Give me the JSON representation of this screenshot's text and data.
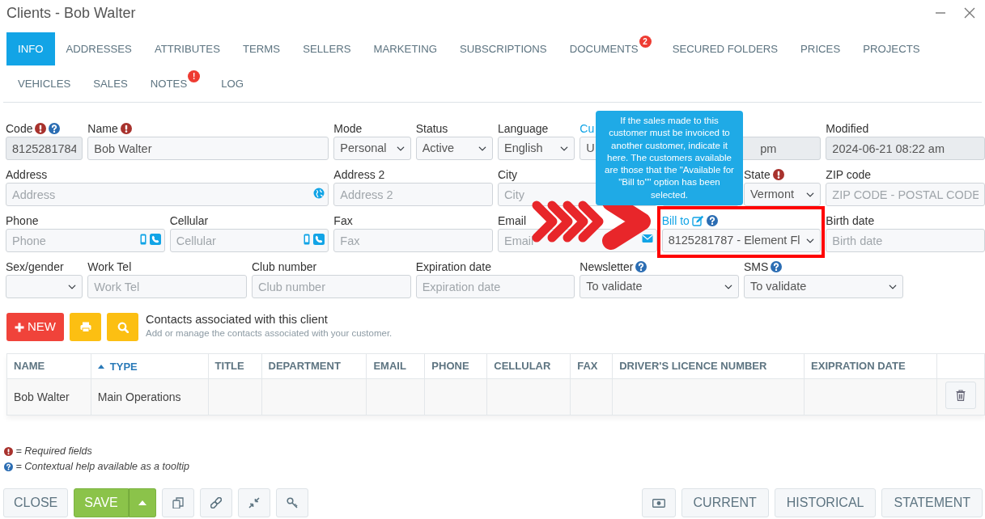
{
  "window": {
    "title": "Clients - Bob Walter"
  },
  "tabs": [
    {
      "label": "INFO",
      "selected": true
    },
    {
      "label": "ADDRESSES",
      "selected": false
    },
    {
      "label": "ATTRIBUTES",
      "selected": false
    },
    {
      "label": "TERMS",
      "selected": false
    },
    {
      "label": "SELLERS",
      "selected": false
    },
    {
      "label": "MARKETING",
      "selected": false
    },
    {
      "label": "SUBSCRIPTIONS",
      "selected": false
    },
    {
      "label": "DOCUMENTS",
      "selected": false,
      "badge": "2"
    },
    {
      "label": "SECURED FOLDERS",
      "selected": false
    },
    {
      "label": "PRICES",
      "selected": false
    },
    {
      "label": "PROJECTS",
      "selected": false
    },
    {
      "label": "VEHICLES",
      "selected": false
    },
    {
      "label": "SALES",
      "selected": false
    },
    {
      "label": "NOTES",
      "selected": false,
      "badge": "!"
    },
    {
      "label": "LOG",
      "selected": false
    }
  ],
  "fields": [
    {
      "kind": "readonly",
      "label": "Code",
      "value": "8125281784",
      "required": true,
      "help": true,
      "link": false
    },
    {
      "kind": "input",
      "label": "Name",
      "value": "Bob Walter",
      "required": true,
      "help": false,
      "link": false
    },
    {
      "kind": "select",
      "label": "Mode",
      "value": "Personal",
      "required": false,
      "help": false,
      "link": false
    },
    {
      "kind": "select",
      "label": "Status",
      "value": "Active",
      "required": false,
      "help": false,
      "link": false
    },
    {
      "kind": "select",
      "label": "Language",
      "value": "English",
      "required": false,
      "help": false,
      "link": false
    },
    {
      "kind": "select",
      "label": "Cu",
      "value": "U",
      "required": false,
      "help": false,
      "link": true
    },
    {
      "kind": "readonly",
      "value": "pm"
    },
    {
      "kind": "readonly",
      "label": "Modified",
      "value": "2024-06-21 08:22 am",
      "required": false,
      "help": false,
      "link": false
    },
    {
      "kind": "input",
      "label": "Address",
      "placeholder": "Address",
      "required": false,
      "help": false,
      "link": false
    },
    {
      "kind": "input",
      "label": "Address 2",
      "placeholder": "Address 2",
      "required": false,
      "help": false,
      "link": false
    },
    {
      "kind": "input",
      "label": "City",
      "placeholder": "City",
      "required": false,
      "help": false,
      "link": false
    },
    {
      "kind": "select"
    },
    {
      "kind": "select",
      "label": "State",
      "value": "Vermont",
      "required": true,
      "help": false,
      "link": false
    },
    {
      "kind": "input",
      "label": "ZIP code",
      "placeholder": "ZIP CODE - POSTAL CODE",
      "required": false,
      "help": false,
      "link": false
    },
    {
      "kind": "input",
      "label": "Phone",
      "placeholder": "Phone",
      "required": false,
      "help": false,
      "link": false
    },
    {
      "kind": "input",
      "label": "Cellular",
      "placeholder": "Cellular",
      "required": false,
      "help": false,
      "link": false
    },
    {
      "kind": "input",
      "label": "Fax",
      "placeholder": "Fax",
      "required": false,
      "help": false,
      "link": false
    },
    {
      "kind": "input",
      "label": "Email",
      "placeholder": "Email",
      "required": false,
      "help": false,
      "link": false
    },
    {
      "kind": "select",
      "label": "Bill to",
      "value": "8125281787 - Element Fl",
      "required": false,
      "help": true,
      "link": true
    },
    {
      "kind": "input",
      "label": "Birth date",
      "placeholder": "Birth date",
      "required": false,
      "help": false,
      "link": false
    },
    {
      "kind": "select",
      "label": "Sex/gender",
      "required": false,
      "help": false,
      "link": false
    },
    {
      "kind": "input",
      "label": "Work Tel",
      "placeholder": "Work Tel",
      "required": false,
      "help": false,
      "link": false
    },
    {
      "kind": "input",
      "label": "Club number",
      "placeholder": "Club number",
      "required": false,
      "help": false,
      "link": false
    },
    {
      "kind": "input",
      "label": "Expiration date",
      "placeholder": "Expiration date",
      "required": false,
      "help": false,
      "link": false
    },
    {
      "kind": "select",
      "label": "Newsletter",
      "value": "To validate",
      "required": false,
      "help": true,
      "link": false
    },
    {
      "kind": "select",
      "label": "SMS",
      "value": "To validate",
      "required": false,
      "help": true,
      "link": false
    }
  ],
  "tooltip": "If the sales made to this customer must be invoiced to another customer, indicate it here. The customers available are those that the \"Available for \"Bill to\"\" option has been selected.",
  "contacts": {
    "new_button": "NEW",
    "title": "Contacts associated with this client",
    "subtitle": "Add or manage the contacts associated with your customer.",
    "columns": [
      {
        "label": "NAME",
        "sorted": false
      },
      {
        "label": "TYPE",
        "sorted": true
      },
      {
        "label": "TITLE",
        "sorted": false
      },
      {
        "label": "DEPARTMENT",
        "sorted": false
      },
      {
        "label": "EMAIL",
        "sorted": false
      },
      {
        "label": "PHONE",
        "sorted": false
      },
      {
        "label": "CELLULAR",
        "sorted": false
      },
      {
        "label": "FAX",
        "sorted": false
      },
      {
        "label": "DRIVER'S LICENCE NUMBER",
        "sorted": false
      },
      {
        "label": "EXIPRATION DATE",
        "sorted": false
      }
    ],
    "rows": [
      {
        "cells": [
          "Bob Walter",
          "Main Operations"
        ]
      }
    ]
  },
  "legend": [
    {
      "kind": "required",
      "text": "= Required fields"
    },
    {
      "kind": "help",
      "text": "= Contextual help available as a tooltip"
    }
  ],
  "footer": {
    "close": "CLOSE",
    "save": "SAVE",
    "reports": [
      "CURRENT",
      "HISTORICAL",
      "STATEMENT"
    ]
  }
}
